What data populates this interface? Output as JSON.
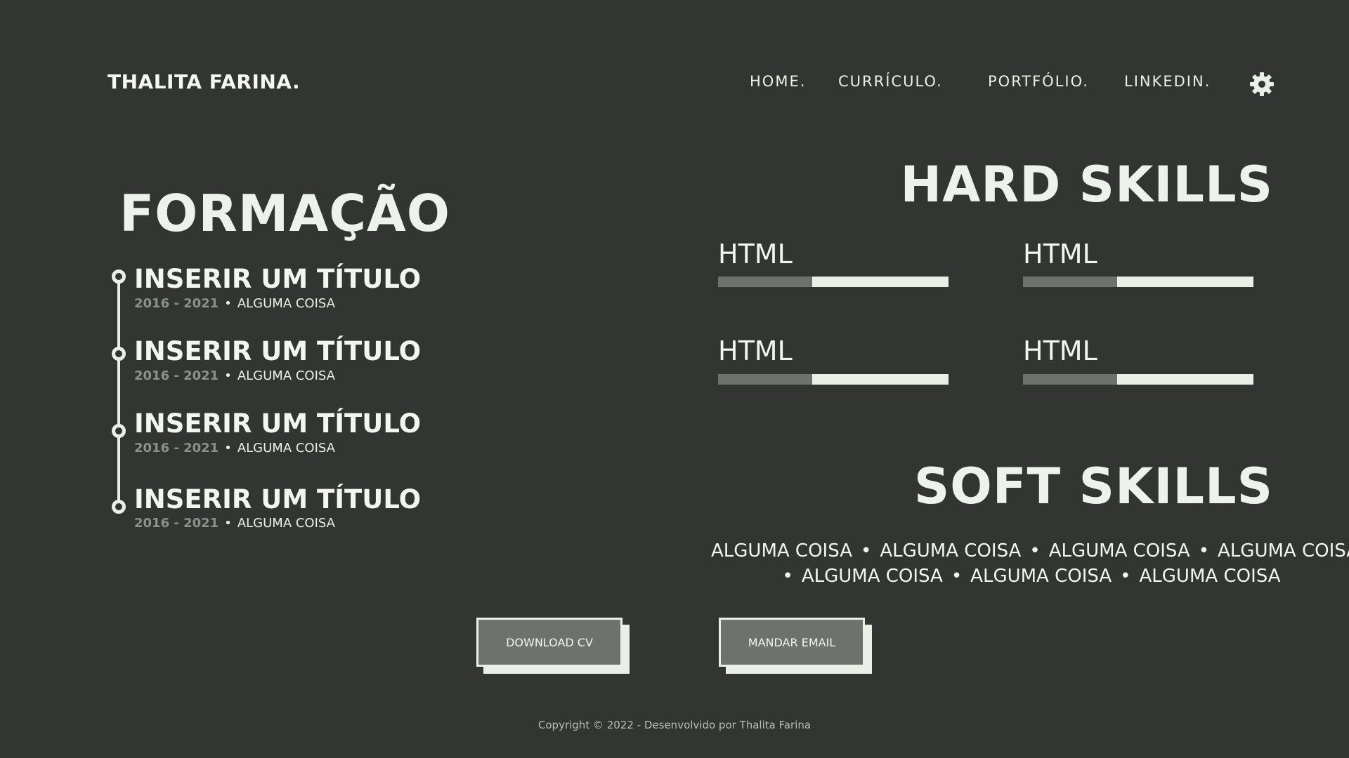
{
  "header": {
    "brand": "THALITA FARINA.",
    "nav": [
      "HOME.",
      "CURRÍCULO.",
      "PORTFÓLIO.",
      "LINKEDIN."
    ],
    "settings_icon": "gear-icon"
  },
  "formacao": {
    "title": "FORMAÇÃO",
    "items": [
      {
        "title": "INSERIR UM TÍTULO",
        "years": "2016 - 2021",
        "separator": "•",
        "desc": "ALGUMA COISA"
      },
      {
        "title": "INSERIR UM TÍTULO",
        "years": "2016 - 2021",
        "separator": "•",
        "desc": "ALGUMA COISA"
      },
      {
        "title": "INSERIR UM TÍTULO",
        "years": "2016 - 2021",
        "separator": "•",
        "desc": "ALGUMA COISA"
      },
      {
        "title": "INSERIR UM TÍTULO",
        "years": "2016 - 2021",
        "separator": "•",
        "desc": "ALGUMA COISA"
      }
    ]
  },
  "hard_skills": {
    "title": "HARD SKILLS",
    "items": [
      {
        "label": "HTML",
        "level": 0.41
      },
      {
        "label": "HTML",
        "level": 0.41
      },
      {
        "label": "HTML",
        "level": 0.41
      },
      {
        "label": "HTML",
        "level": 0.41
      }
    ]
  },
  "soft_skills": {
    "title": "SOFT SKILLS",
    "items": [
      "ALGUMA COISA",
      "ALGUMA COISA",
      "ALGUMA COISA",
      "ALGUMA COISA",
      "ALGUMA COISA",
      "ALGUMA COISA",
      "ALGUMA COISA"
    ],
    "separator": "•"
  },
  "buttons": {
    "download": "DOWNLOAD CV",
    "email": "MANDAR EMAIL"
  },
  "footer": {
    "copyright": "Copyright © 2022 - Desenvolvido por Thalita Farina"
  },
  "colors": {
    "background": "#333533",
    "light": "#eaf0e8",
    "muted": "#6d726c"
  }
}
